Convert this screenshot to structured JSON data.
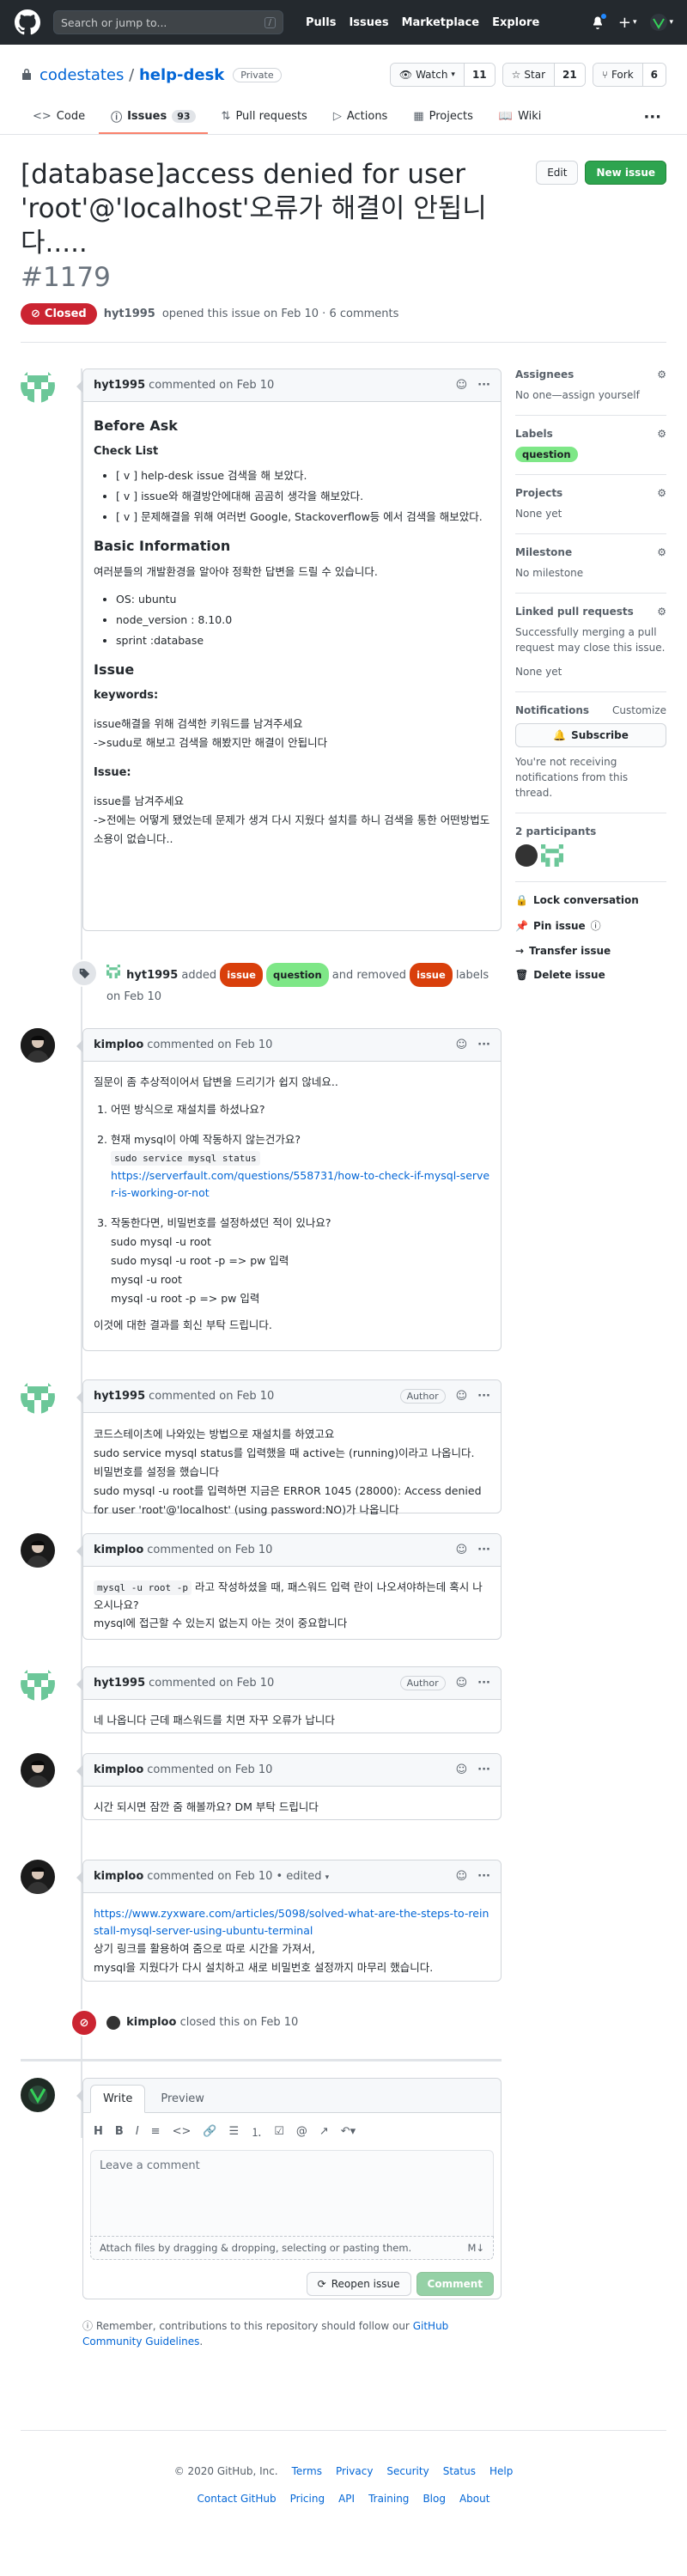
{
  "header": {
    "search_placeholder": "Search or jump to...",
    "slash_key": "/",
    "nav": [
      "Pulls",
      "Issues",
      "Marketplace",
      "Explore"
    ]
  },
  "repo": {
    "owner": "codestates",
    "separator": "/",
    "name": "help-desk",
    "visibility": "Private",
    "watch_label": "Watch",
    "watch_count": "11",
    "star_label": "Star",
    "star_count": "21",
    "fork_label": "Fork",
    "fork_count": "6",
    "tabs": [
      {
        "label": "Code"
      },
      {
        "label": "Issues",
        "count": "93"
      },
      {
        "label": "Pull requests"
      },
      {
        "label": "Actions"
      },
      {
        "label": "Projects"
      },
      {
        "label": "Wiki"
      }
    ]
  },
  "issue": {
    "title": "[database]access denied for user 'root'@'localhost'오류가 해결이 안됩니다.....",
    "number": "#1179",
    "state": "Closed",
    "author": "hyt1995",
    "opened_text": "opened this issue on Feb 10 · 6 comments",
    "edit_label": "Edit",
    "new_issue_label": "New issue"
  },
  "comments": [
    {
      "author": "hyt1995",
      "when": "commented on Feb 10",
      "h_before": "Before Ask",
      "h_check": "Check List",
      "checks": [
        "[ v ] help-desk issue 검색을 해 보았다.",
        "[ v ] issue와 해결방안에대해 곰곰히 생각을 해보았다.",
        "[ v ] 문제해결을 위해 여러번 Google, Stackoverflow등 에서 검색을 해보았다."
      ],
      "h_basic": "Basic Information",
      "basic_intro": "여러분들의 개발환경을 알아야 정확한 답변을 드릴 수 있습니다.",
      "env": [
        "OS: ubuntu",
        "node_version : 8.10.0",
        "sprint :database"
      ],
      "h_issue": "Issue",
      "h_keywords": "keywords:",
      "kw1": "issue해결을 위해 검색한 키워드를 남겨주세요",
      "kw2": "->sudu로 해보고 검색을 해봤지만 해결이 안됩니다",
      "h_issue2": "Issue:",
      "is1": "issue를 남겨주세요",
      "is2": "->전에는 어떻게 됐었는데 문제가 생겨 다시 지웠다 설치를 하니 검색을 통한 어떤방법도 소용이 없습니다.."
    },
    {
      "author": "kimploo",
      "when": "commented on Feb 10",
      "intro": "질문이 좀 추상적이어서 답변을 드리기가 쉽지 않네요..",
      "q1": "어떤 방식으로 재설치를 하셨나요?",
      "q2": "현재 mysql이 아예 작동하지 않는건가요?",
      "q2_code": "sudo service mysql status",
      "q2_link": "https://serverfault.com/questions/558731/how-to-check-if-mysql-server-is-working-or-not",
      "q3": "작동한다면, 비밀번호를 설정하셨던 적이 있나요?",
      "q3_lines": [
        "sudo mysql -u root",
        "sudo mysql -u root -p => pw 입력",
        "mysql -u root",
        "mysql -u root -p => pw 입력"
      ],
      "outro": "이것에 대한 결과를 회신 부탁 드립니다."
    },
    {
      "author": "hyt1995",
      "when": "commented on Feb 10",
      "badge": "Author",
      "lines": [
        "코드스테이츠에 나와있는 방법으로 재설치를 하였고요",
        "sudo service mysql status를 입력했을 때 active는 (running)이라고 나옵니다.",
        "비밀번호를 설정을 했습니다",
        "sudo mysql -u root를 입력하면 지금은 ERROR 1045 (28000): Access denied for user 'root'@'localhost' (using password:NO)가 나옵니다"
      ]
    },
    {
      "author": "kimploo",
      "when": "commented on Feb 10",
      "code": "mysql -u root -p",
      "text1": "라고 작성하셨을 때, 패스워드 입력 란이 나오셔야하는데 혹시 나오시나요?",
      "text2": "mysql에 접근할 수 있는지 없는지 아는 것이 중요합니다"
    },
    {
      "author": "hyt1995",
      "when": "commented on Feb 10",
      "badge": "Author",
      "text": "네 나옵니다 근데 패스워드를 치면 자꾸 오류가 납니다"
    },
    {
      "author": "kimploo",
      "when": "commented on Feb 10",
      "text": "시간 되시면 잠깐 줌 해볼까요? DM 부탁 드립니다"
    },
    {
      "author": "kimploo",
      "when": "commented on Feb 10",
      "edited": "• edited",
      "link": "https://www.zyxware.com/articles/5098/solved-what-are-the-steps-to-reinstall-mysql-server-using-ubuntu-terminal",
      "text1": "상기 링크를 활용하여 줌으로 따로 시간을 가져서,",
      "text2": "mysql을 지웠다가 다시 설치하고 새로 비밀번호 설정까지 마무리 했습니다."
    }
  ],
  "events": {
    "label_event": {
      "actor": "hyt1995",
      "added": "added",
      "label1": "issue",
      "label2": "question",
      "removed": "and removed",
      "label3": "issue",
      "suffix": "labels",
      "when": "on Feb 10"
    },
    "close_event": {
      "actor": "kimploo",
      "text": "closed this",
      "when": "on Feb 10"
    }
  },
  "sidebar": {
    "assignees_h": "Assignees",
    "assignees_v": "No one—assign yourself",
    "labels_h": "Labels",
    "label": "question",
    "projects_h": "Projects",
    "projects_v": "None yet",
    "milestone_h": "Milestone",
    "milestone_v": "No milestone",
    "linked_h": "Linked pull requests",
    "linked_v": "Successfully merging a pull request may close this issue.",
    "linked_none": "None yet",
    "notif_h": "Notifications",
    "customize": "Customize",
    "subscribe": "Subscribe",
    "notif_v": "You're not receiving notifications from this thread.",
    "participants_h": "2 participants",
    "lock": "Lock conversation",
    "pin": "Pin issue",
    "transfer": "Transfer issue",
    "delete": "Delete issue"
  },
  "editor": {
    "tab_write": "Write",
    "tab_preview": "Preview",
    "placeholder": "Leave a comment",
    "attach": "Attach files by dragging & dropping, selecting or pasting them.",
    "reopen": "Reopen issue",
    "comment": "Comment",
    "tip_prefix": "Remember, contributions to this repository should follow our",
    "tip_link": "GitHub Community Guidelines",
    "tip_suffix": "."
  },
  "footer": {
    "copyright": "© 2020 GitHub, Inc.",
    "row1": [
      "Terms",
      "Privacy",
      "Security",
      "Status",
      "Help"
    ],
    "row2": [
      "Contact GitHub",
      "Pricing",
      "API",
      "Training",
      "Blog",
      "About"
    ]
  },
  "colors": {
    "closed": "#cb2431",
    "issue_label": "#d93f0b",
    "question_label": "#7ee787",
    "accent": "#0366d6"
  }
}
